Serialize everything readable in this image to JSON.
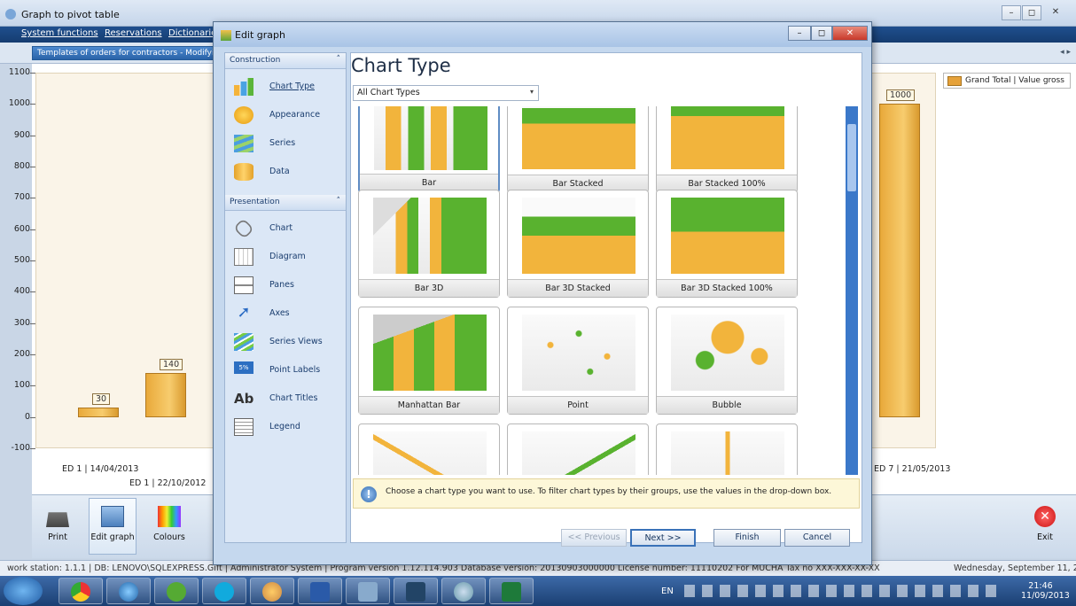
{
  "window": {
    "title": "Graph to pivot table"
  },
  "menu": {
    "items": [
      "System functions",
      "Reservations",
      "Dictionaries"
    ]
  },
  "inner_tab": {
    "label": "Templates of orders for contractors - Modifying"
  },
  "chart_data": {
    "type": "bar",
    "ylim": [
      -100,
      1100
    ],
    "yticks": [
      "1100",
      "1000",
      "900",
      "800",
      "700",
      "600",
      "500",
      "400",
      "300",
      "200",
      "100",
      "0",
      "-100"
    ],
    "categories": [
      "ED 1 | 14/04/2013",
      "ED 1 | 22/10/2012",
      "ED 7 | 21/05/2013"
    ],
    "values": [
      30,
      140,
      1000
    ],
    "value_labels": [
      "30",
      "140",
      "1000"
    ],
    "legend": "Grand Total | Value gross"
  },
  "toolbar": {
    "print": "Print",
    "edit_graph": "Edit graph",
    "colours": "Colours",
    "exit": "Exit"
  },
  "status": {
    "workstation": "work station: 1.1.1",
    "db": "DB: LENOVO\\SQLEXPRESS.Gift",
    "user": "Administrator System",
    "program": "Program version 1.12.114.903 Database version: 20130903000000 License number: 11110202 For MUCHA Tax no XXX-XXX-XX-XX",
    "date": "Wednesday, September 11, 2"
  },
  "taskbar": {
    "lang": "EN",
    "time": "21:46",
    "date": "11/09/2013"
  },
  "dialog": {
    "title": "Edit graph",
    "construction": {
      "header": "Construction",
      "items": [
        "Chart Type",
        "Appearance",
        "Series",
        "Data"
      ]
    },
    "presentation": {
      "header": "Presentation",
      "items": [
        "Chart",
        "Diagram",
        "Panes",
        "Axes",
        "Series Views",
        "Point Labels",
        "Chart Titles",
        "Legend"
      ]
    },
    "content_title": "Chart Type",
    "filter": "All Chart Types",
    "chart_types": [
      "Bar",
      "Bar Stacked",
      "Bar Stacked 100%",
      "Bar 3D",
      "Bar 3D Stacked",
      "Bar 3D Stacked 100%",
      "Manhattan Bar",
      "Point",
      "Bubble",
      "",
      "",
      ""
    ],
    "hint": "Choose a chart type you want to use. To filter chart types by their groups, use the values in the drop-down box.",
    "buttons": {
      "previous": "<< Previous",
      "next": "Next >>",
      "finish": "Finish",
      "cancel": "Cancel"
    }
  }
}
